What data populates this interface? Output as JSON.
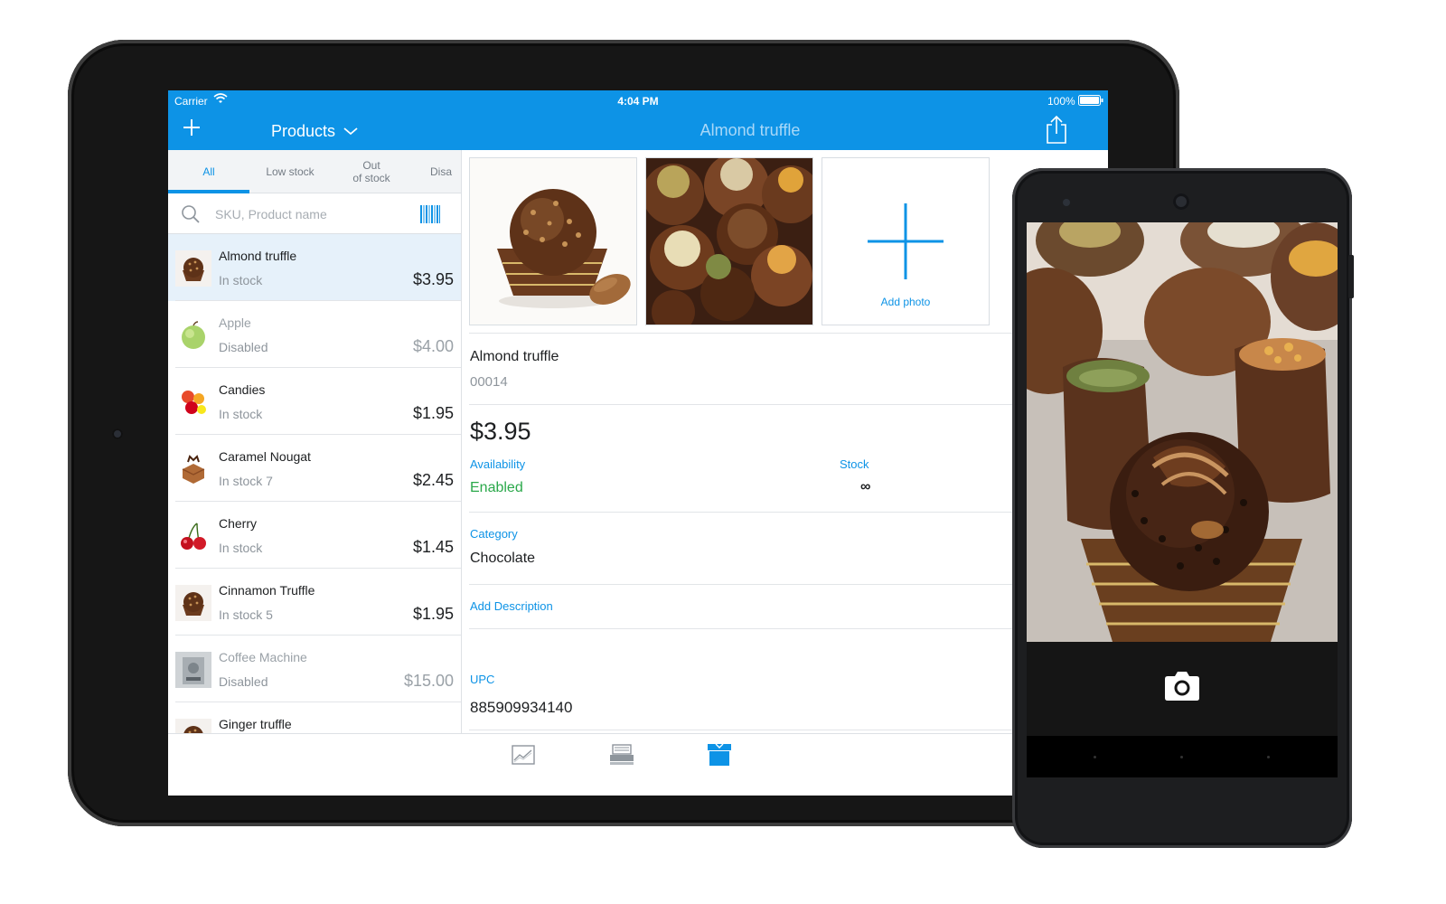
{
  "status_bar": {
    "carrier": "Carrier",
    "time": "4:04 PM",
    "battery": "100%"
  },
  "master": {
    "title": "Products",
    "tabs": [
      {
        "label": "All",
        "active": true
      },
      {
        "label": "Low stock",
        "active": false
      },
      {
        "label": "Out\nof stock",
        "active": false
      },
      {
        "label": "Disa",
        "active": false
      }
    ],
    "search_placeholder": "SKU, Product name",
    "products": [
      {
        "name": "Almond truffle",
        "status": "In stock",
        "price": "$3.95",
        "selected": true,
        "disabled": false,
        "thumb": "truffle"
      },
      {
        "name": "Apple",
        "status": "Disabled",
        "price": "$4.00",
        "selected": false,
        "disabled": true,
        "thumb": "apple"
      },
      {
        "name": "Candies",
        "status": "In stock",
        "price": "$1.95",
        "selected": false,
        "disabled": false,
        "thumb": "candies"
      },
      {
        "name": "Caramel Nougat",
        "status": "In stock 7",
        "price": "$2.45",
        "selected": false,
        "disabled": false,
        "thumb": "nougat"
      },
      {
        "name": "Cherry",
        "status": "In stock",
        "price": "$1.45",
        "selected": false,
        "disabled": false,
        "thumb": "cherry"
      },
      {
        "name": "Cinnamon Truffle",
        "status": "In stock 5",
        "price": "$1.95",
        "selected": false,
        "disabled": false,
        "thumb": "truffle"
      },
      {
        "name": "Coffee Machine",
        "status": "Disabled",
        "price": "$15.00",
        "selected": false,
        "disabled": true,
        "thumb": "machine"
      },
      {
        "name": "Ginger truffle",
        "status": "",
        "price": "",
        "selected": false,
        "disabled": false,
        "thumb": "truffle"
      }
    ]
  },
  "detail": {
    "title": "Almond truffle",
    "add_photo": "Add photo",
    "name": "Almond truffle",
    "sku": "00014",
    "price": "$3.95",
    "availability_label": "Availability",
    "availability_value": "Enabled",
    "stock_label": "Stock",
    "stock_value": "∞",
    "category_label": "Category",
    "category_value": "Chocolate",
    "add_description": "Add Description",
    "upc_label": "UPC",
    "upc_value": "885909934140"
  },
  "bottom_tabs": [
    {
      "icon": "chart-icon",
      "active": false
    },
    {
      "icon": "register-icon",
      "active": false
    },
    {
      "icon": "box-icon",
      "active": true
    }
  ],
  "colors": {
    "accent": "#0d93e6",
    "enabled": "#2aa84a",
    "screen_bg": "#ffffff"
  }
}
